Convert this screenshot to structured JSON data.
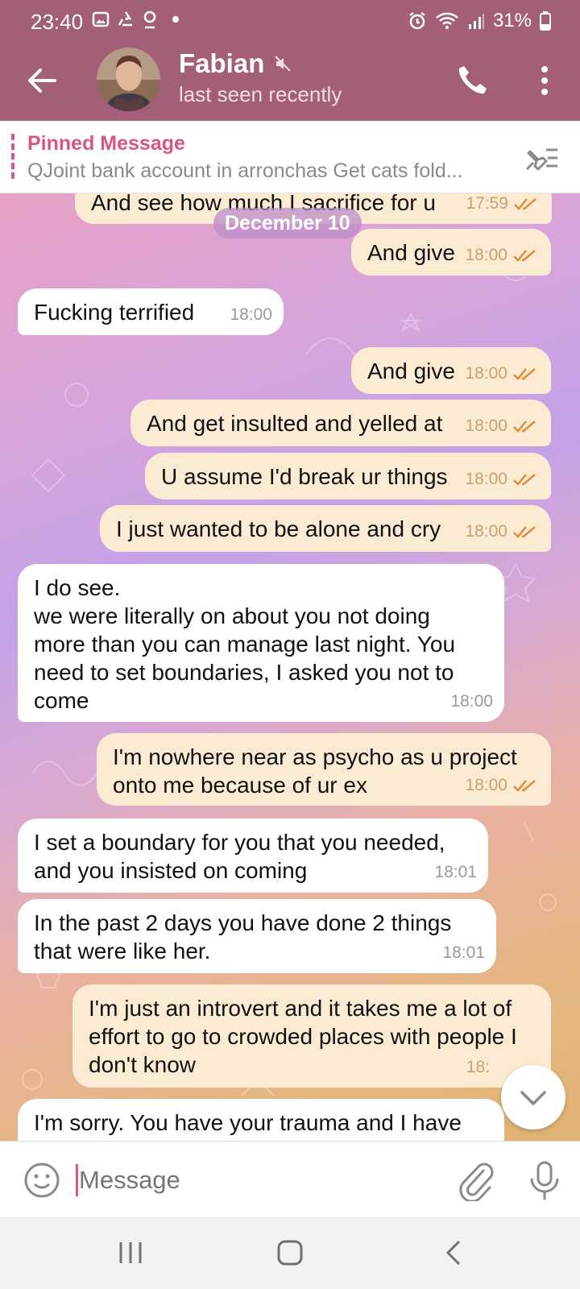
{
  "status": {
    "time": "23:40",
    "battery": "31%"
  },
  "header": {
    "name": "Fabian",
    "status": "last seen recently"
  },
  "pinned": {
    "title": "Pinned Message",
    "text": "QJoint bank account in arronchas  Get cats fold..."
  },
  "date_label": "December 10",
  "messages": [
    {
      "dir": "out",
      "text": "And see how much I sacrifice for u",
      "time": "17:59"
    },
    {
      "dir": "out",
      "text": "And give",
      "time": "18:00"
    },
    {
      "dir": "in",
      "text": "Fucking terrified",
      "time": "18:00"
    },
    {
      "dir": "out",
      "text": "And give",
      "time": "18:00"
    },
    {
      "dir": "out",
      "text": "And get insulted and yelled at",
      "time": "18:00"
    },
    {
      "dir": "out",
      "text": "U assume I'd break ur things",
      "time": "18:00"
    },
    {
      "dir": "out",
      "text": "I just wanted to be alone and cry",
      "time": "18:00"
    },
    {
      "dir": "in",
      "text": "I do see.\nwe were literally on about you not doing more than you can manage last night. You need to set boundaries, I asked you not to come",
      "time": "18:00"
    },
    {
      "dir": "out",
      "text": "I'm nowhere near as psycho as u project onto me because of ur ex",
      "time": "18:00"
    },
    {
      "dir": "in",
      "text": "I set a boundary for you that you needed, and you insisted on coming",
      "time": "18:01"
    },
    {
      "dir": "in",
      "text": "In the past 2 days you have done 2 things that were like her.",
      "time": "18:01"
    },
    {
      "dir": "out",
      "text": "I'm just an introvert and it takes me a lot of effort to go to crowded places with people I don't know",
      "time": "18:"
    },
    {
      "dir": "in",
      "text": "I'm sorry. You have your trauma and I have",
      "time": ""
    }
  ],
  "composer": {
    "placeholder": "Message"
  },
  "colors": {
    "accent": "#a45f78",
    "out_bubble": "#fcebd3",
    "pin": "#d8567f"
  }
}
